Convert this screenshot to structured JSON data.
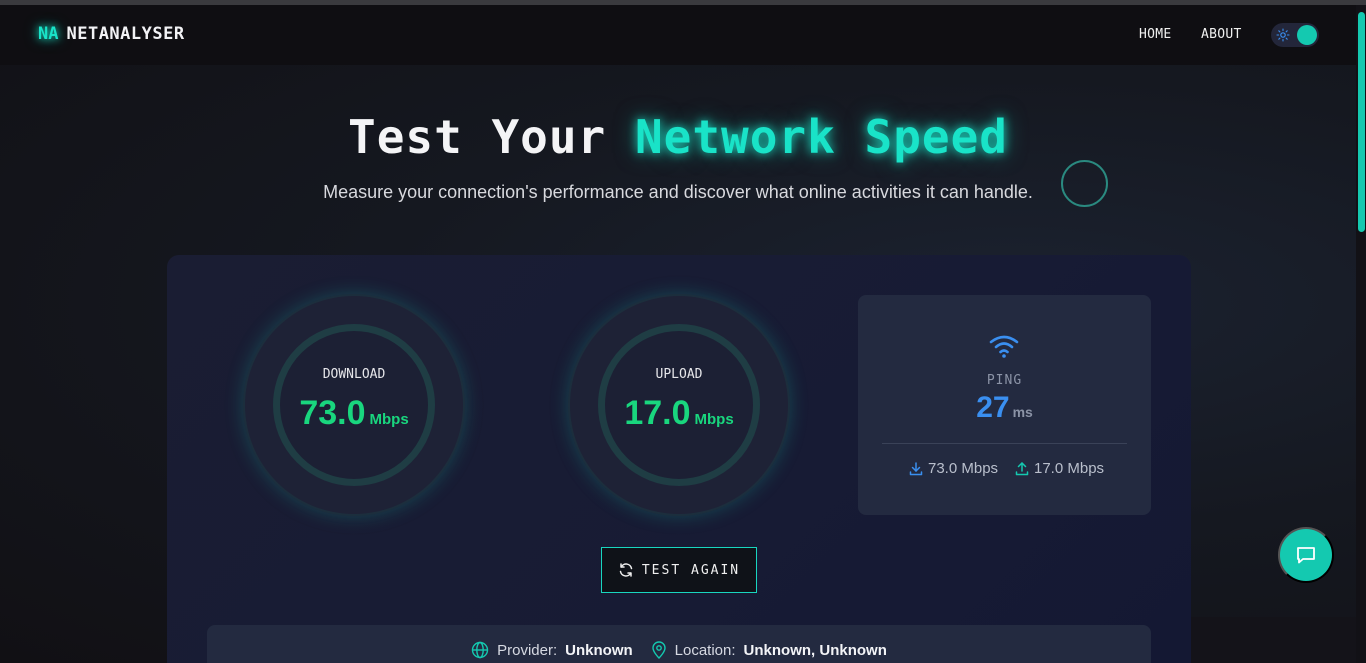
{
  "brand": {
    "mark": "NA",
    "name": "NETANALYSER"
  },
  "nav": {
    "home": "HOME",
    "about": "ABOUT"
  },
  "theme_toggle": {
    "state": "on",
    "accent": "#14c9b0"
  },
  "hero": {
    "title_plain": "Test Your",
    "title_accent": "Network Speed",
    "subtitle": "Measure your connection's performance and discover what online activities it can handle."
  },
  "download": {
    "label": "DOWNLOAD",
    "value": "73.0",
    "unit": "Mbps"
  },
  "upload": {
    "label": "UPLOAD",
    "value": "17.0",
    "unit": "Mbps"
  },
  "ping": {
    "label": "PING",
    "value": "27",
    "unit": "ms",
    "download_summary": "73.0 Mbps",
    "upload_summary": "17.0 Mbps"
  },
  "test_button": {
    "label": "TEST AGAIN",
    "icon": "refresh-icon"
  },
  "info": {
    "provider_label": "Provider:",
    "provider_value": "Unknown",
    "location_label": "Location:",
    "location_value": "Unknown, Unknown"
  },
  "chat": {
    "icon": "chat-icon"
  },
  "colors": {
    "accent": "#19e3c8",
    "speed": "#19d67e",
    "ping": "#3a8ff0"
  }
}
